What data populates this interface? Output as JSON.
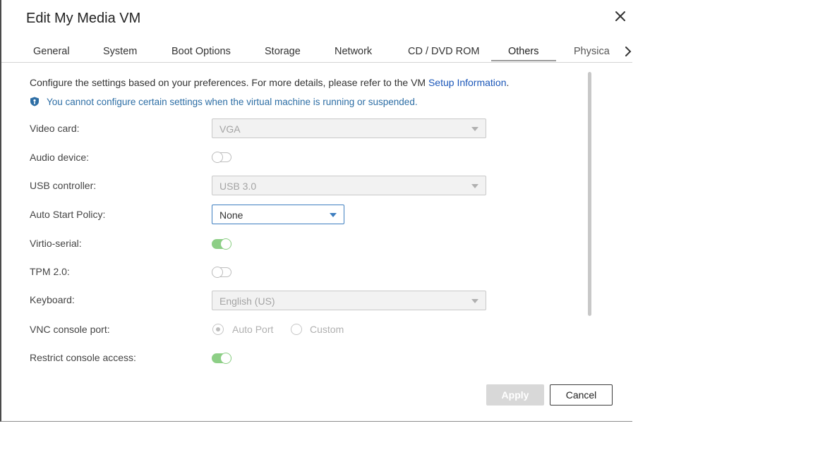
{
  "dialog": {
    "title": "Edit My Media VM"
  },
  "tabs": [
    {
      "label": "General"
    },
    {
      "label": "System"
    },
    {
      "label": "Boot Options"
    },
    {
      "label": "Storage"
    },
    {
      "label": "Network"
    },
    {
      "label": "CD / DVD ROM"
    },
    {
      "label": "Others",
      "active": true
    },
    {
      "label": "Physica"
    }
  ],
  "intro": {
    "text": "Configure the settings based on your preferences. For more details, please refer to the VM ",
    "link": "Setup Information",
    "suffix": "."
  },
  "notice": "You cannot configure certain settings when the virtual machine is running or suspended.",
  "fields": {
    "video_card": {
      "label": "Video card:",
      "value": "VGA"
    },
    "audio_device": {
      "label": "Audio device:",
      "enabled": false
    },
    "usb_controller": {
      "label": "USB controller:",
      "value": "USB 3.0"
    },
    "auto_start": {
      "label": "Auto Start Policy:",
      "value": "None"
    },
    "virtio_serial": {
      "label": "Virtio-serial:",
      "enabled": true
    },
    "tpm": {
      "label": "TPM 2.0:",
      "enabled": false
    },
    "keyboard": {
      "label": "Keyboard:",
      "value": "English (US)"
    },
    "vnc_port": {
      "label": "VNC console port:",
      "options": [
        "Auto Port",
        "Custom"
      ],
      "selected": "Auto Port"
    },
    "restrict_console": {
      "label": "Restrict console access:",
      "enabled": true
    }
  },
  "buttons": {
    "apply": "Apply",
    "cancel": "Cancel"
  },
  "colors": {
    "link": "#1a56b8",
    "notice": "#2d6ea5",
    "toggle_on": "#8dcf86",
    "select_focus": "#3e7ec0"
  }
}
